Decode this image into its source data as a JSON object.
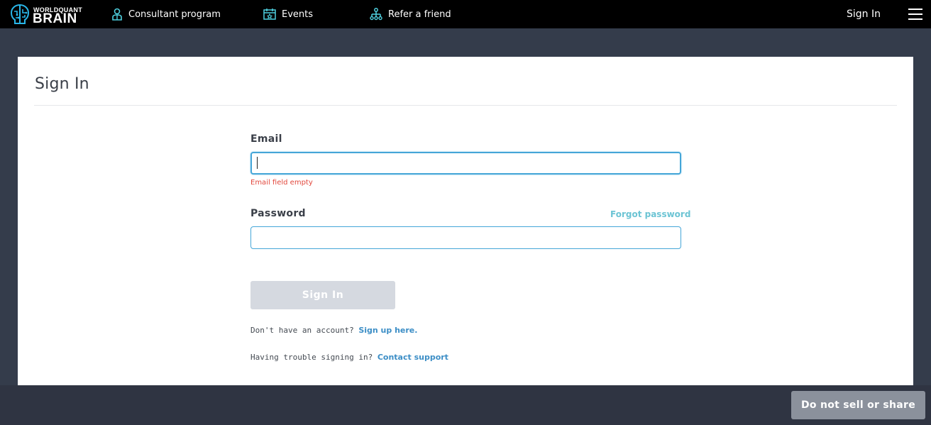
{
  "header": {
    "logo": {
      "line1": "WORLDQUANT",
      "line2": "BRAIN"
    },
    "nav": [
      {
        "label": "Consultant program",
        "icon": "consultant-icon"
      },
      {
        "label": "Events",
        "icon": "calendar-icon"
      },
      {
        "label": "Refer a friend",
        "icon": "network-icon"
      }
    ],
    "signin_label": "Sign In",
    "menu_icon": "hamburger-menu-icon"
  },
  "card": {
    "title": "Sign In",
    "email": {
      "label": "Email",
      "value": "",
      "placeholder": "",
      "error": "Email field empty"
    },
    "password": {
      "label": "Password",
      "value": "",
      "placeholder": "",
      "forgot_label": "Forgot password"
    },
    "submit_label": "Sign In",
    "signup": {
      "prompt": "Don't have an account?",
      "link": "Sign up here."
    },
    "support": {
      "prompt": "Having trouble signing in?",
      "link": "Contact support"
    }
  },
  "footer": {
    "privacy_button": "Do not sell or share"
  },
  "colors": {
    "accent": "#45a6d8",
    "link": "#3c8ec6",
    "forgot_link": "#6cc4d4",
    "error": "#e2483d",
    "disabled_button": "#d5d9e0",
    "page_bg": "#343c4b"
  }
}
